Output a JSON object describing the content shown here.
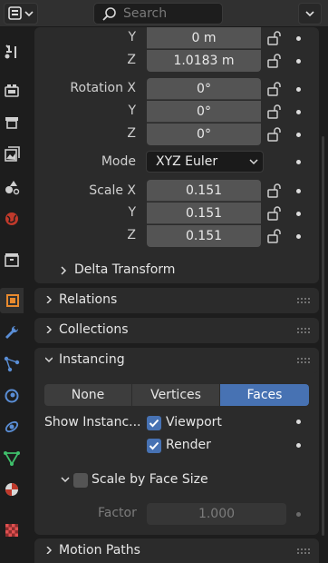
{
  "header": {
    "search_placeholder": "Search"
  },
  "transform": {
    "loc_y_label": "Y",
    "loc_y_value": "0 m",
    "loc_z_label": "Z",
    "loc_z_value": "1.0183 m",
    "rotation_x_label": "Rotation X",
    "rotation_x_value": "0°",
    "rotation_y_label": "Y",
    "rotation_y_value": "0°",
    "rotation_z_label": "Z",
    "rotation_z_value": "0°",
    "mode_label": "Mode",
    "mode_value": "XYZ Euler",
    "scale_x_label": "Scale X",
    "scale_x_value": "0.151",
    "scale_y_label": "Y",
    "scale_y_value": "0.151",
    "scale_z_label": "Z",
    "scale_z_value": "0.151",
    "delta_label": "Delta Transform"
  },
  "sections": {
    "relations": "Relations",
    "collections": "Collections",
    "instancing": "Instancing",
    "motion_paths": "Motion Paths"
  },
  "instancing": {
    "modes": [
      "None",
      "Vertices",
      "Faces"
    ],
    "active_mode": "Faces",
    "show_label": "Show Instanc...",
    "viewport_label": "Viewport",
    "render_label": "Render",
    "scale_by_face_label": "Scale by Face Size",
    "factor_label": "Factor",
    "factor_value": "1.000"
  },
  "colors": {
    "accent": "#4772b3",
    "panel": "#2b2b2b",
    "field": "#545454",
    "background": "#1d1d1d"
  }
}
